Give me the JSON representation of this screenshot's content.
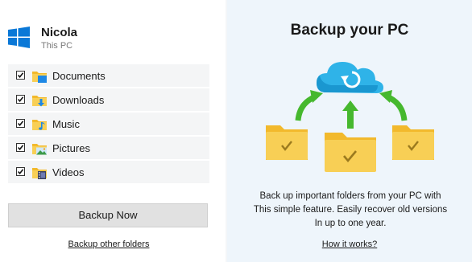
{
  "account": {
    "name": "Nicola",
    "subtitle": "This PC"
  },
  "folders": [
    {
      "label": "Documents",
      "checked": true,
      "icon": "documents-folder-icon"
    },
    {
      "label": "Downloads",
      "checked": true,
      "icon": "downloads-folder-icon"
    },
    {
      "label": "Music",
      "checked": true,
      "icon": "music-folder-icon"
    },
    {
      "label": "Pictures",
      "checked": true,
      "icon": "pictures-folder-icon"
    },
    {
      "label": "Videos",
      "checked": true,
      "icon": "videos-folder-icon"
    }
  ],
  "actions": {
    "backup_now_label": "Backup Now",
    "backup_other_label": "Backup other folders"
  },
  "promo": {
    "title": "Backup your PC",
    "description_lines": [
      "Back up important folders from your PC with",
      "This simple feature. Easily recover old versions",
      "In up to one year."
    ],
    "how_it_works_label": "How it works?"
  },
  "colors": {
    "windows_blue": "#0a78d7",
    "cloud_blue": "#2fb3e8",
    "arrow_green": "#46b82e",
    "folder_yellow": "#f7c948",
    "panel_bg": "#eef5fb"
  }
}
